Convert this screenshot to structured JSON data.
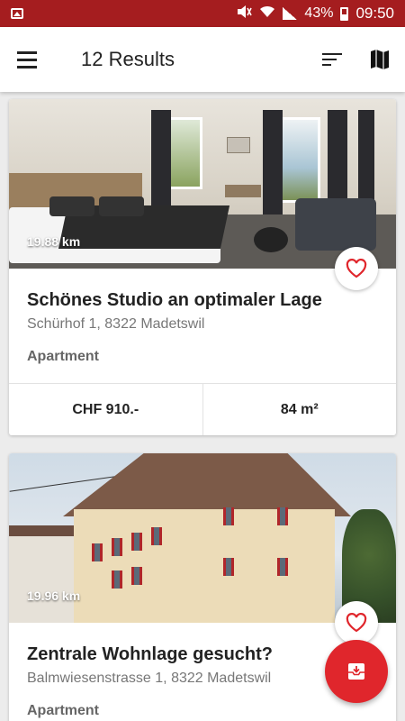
{
  "status_bar": {
    "battery": "43%",
    "time": "09:50"
  },
  "app_bar": {
    "title": "12 Results"
  },
  "listings": [
    {
      "distance": "19.88 km",
      "title": "Schönes Studio an optimaler Lage",
      "address": "Schürhof 1, 8322 Madetswil",
      "type": "Apartment",
      "price": "CHF 910.-",
      "area": "84 m²"
    },
    {
      "distance": "19.96 km",
      "title": "Zentrale Wohnlage gesucht?",
      "address": "Balmwiesenstrasse 1, 8322 Madetswil",
      "type": "Apartment"
    }
  ],
  "colors": {
    "status_bar": "#a51d1f",
    "accent": "#e0262c"
  },
  "icons": {
    "menu": "menu-icon",
    "sort": "sort-icon",
    "map": "map-icon",
    "favorite": "heart-icon",
    "fab": "archive-icon"
  }
}
